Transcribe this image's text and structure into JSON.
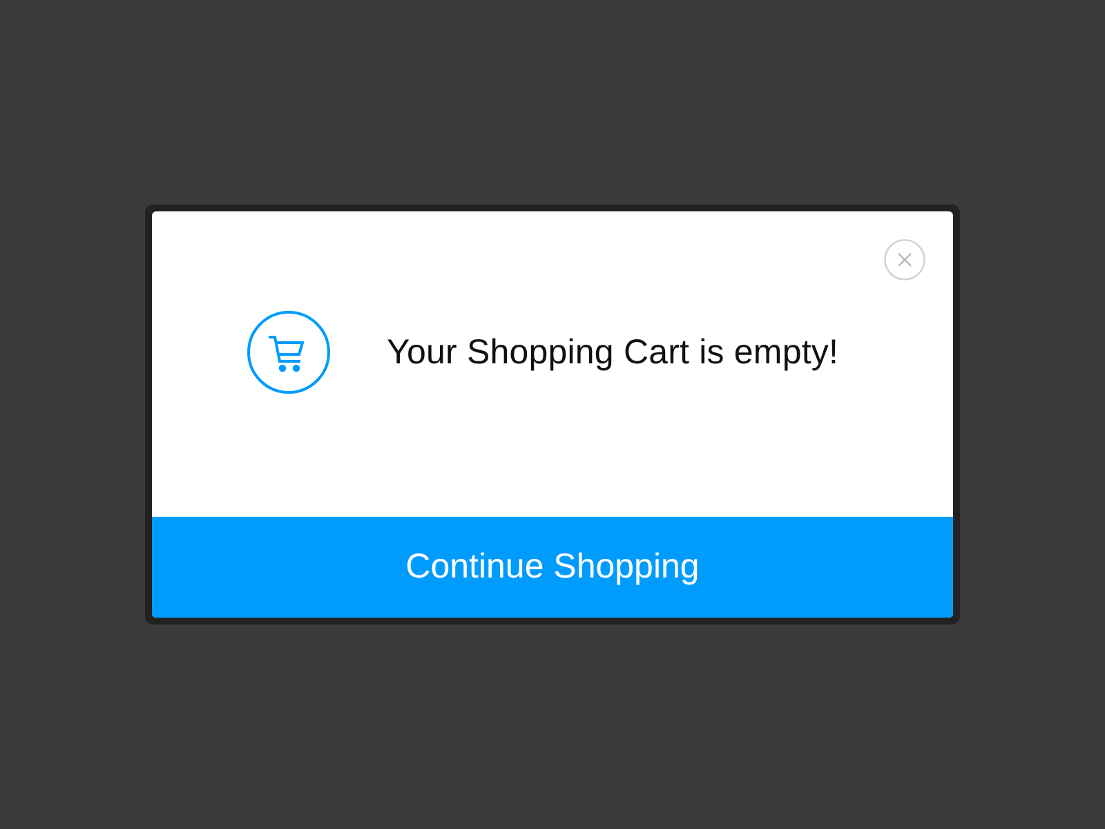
{
  "dialog": {
    "message": "Your Shopping Cart is empty!",
    "button": "Continue Shopping"
  }
}
